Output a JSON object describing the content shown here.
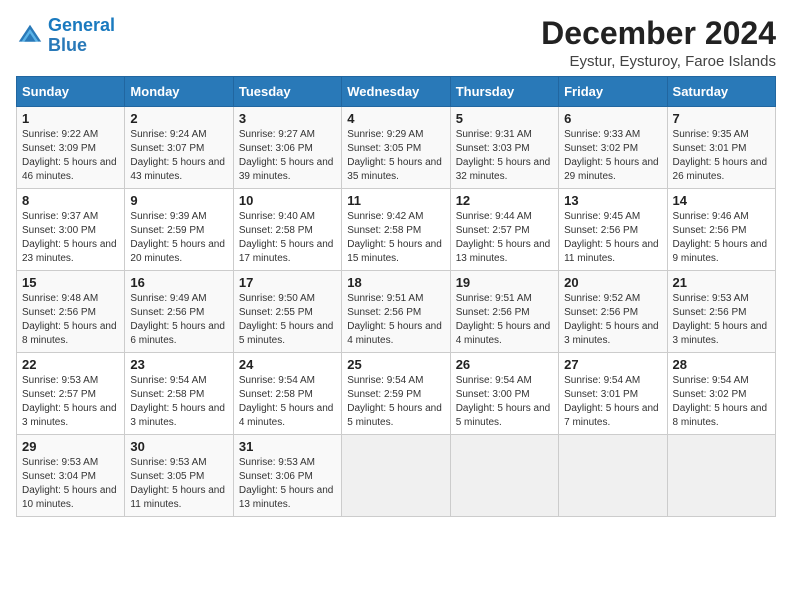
{
  "logo": {
    "line1": "General",
    "line2": "Blue"
  },
  "title": "December 2024",
  "subtitle": "Eystur, Eysturoy, Faroe Islands",
  "headers": [
    "Sunday",
    "Monday",
    "Tuesday",
    "Wednesday",
    "Thursday",
    "Friday",
    "Saturday"
  ],
  "weeks": [
    [
      {
        "day": "1",
        "sunrise": "9:22 AM",
        "sunset": "3:09 PM",
        "daylight": "5 hours and 46 minutes."
      },
      {
        "day": "2",
        "sunrise": "9:24 AM",
        "sunset": "3:07 PM",
        "daylight": "5 hours and 43 minutes."
      },
      {
        "day": "3",
        "sunrise": "9:27 AM",
        "sunset": "3:06 PM",
        "daylight": "5 hours and 39 minutes."
      },
      {
        "day": "4",
        "sunrise": "9:29 AM",
        "sunset": "3:05 PM",
        "daylight": "5 hours and 35 minutes."
      },
      {
        "day": "5",
        "sunrise": "9:31 AM",
        "sunset": "3:03 PM",
        "daylight": "5 hours and 32 minutes."
      },
      {
        "day": "6",
        "sunrise": "9:33 AM",
        "sunset": "3:02 PM",
        "daylight": "5 hours and 29 minutes."
      },
      {
        "day": "7",
        "sunrise": "9:35 AM",
        "sunset": "3:01 PM",
        "daylight": "5 hours and 26 minutes."
      }
    ],
    [
      {
        "day": "8",
        "sunrise": "9:37 AM",
        "sunset": "3:00 PM",
        "daylight": "5 hours and 23 minutes."
      },
      {
        "day": "9",
        "sunrise": "9:39 AM",
        "sunset": "2:59 PM",
        "daylight": "5 hours and 20 minutes."
      },
      {
        "day": "10",
        "sunrise": "9:40 AM",
        "sunset": "2:58 PM",
        "daylight": "5 hours and 17 minutes."
      },
      {
        "day": "11",
        "sunrise": "9:42 AM",
        "sunset": "2:58 PM",
        "daylight": "5 hours and 15 minutes."
      },
      {
        "day": "12",
        "sunrise": "9:44 AM",
        "sunset": "2:57 PM",
        "daylight": "5 hours and 13 minutes."
      },
      {
        "day": "13",
        "sunrise": "9:45 AM",
        "sunset": "2:56 PM",
        "daylight": "5 hours and 11 minutes."
      },
      {
        "day": "14",
        "sunrise": "9:46 AM",
        "sunset": "2:56 PM",
        "daylight": "5 hours and 9 minutes."
      }
    ],
    [
      {
        "day": "15",
        "sunrise": "9:48 AM",
        "sunset": "2:56 PM",
        "daylight": "5 hours and 8 minutes."
      },
      {
        "day": "16",
        "sunrise": "9:49 AM",
        "sunset": "2:56 PM",
        "daylight": "5 hours and 6 minutes."
      },
      {
        "day": "17",
        "sunrise": "9:50 AM",
        "sunset": "2:55 PM",
        "daylight": "5 hours and 5 minutes."
      },
      {
        "day": "18",
        "sunrise": "9:51 AM",
        "sunset": "2:56 PM",
        "daylight": "5 hours and 4 minutes."
      },
      {
        "day": "19",
        "sunrise": "9:51 AM",
        "sunset": "2:56 PM",
        "daylight": "5 hours and 4 minutes."
      },
      {
        "day": "20",
        "sunrise": "9:52 AM",
        "sunset": "2:56 PM",
        "daylight": "5 hours and 3 minutes."
      },
      {
        "day": "21",
        "sunrise": "9:53 AM",
        "sunset": "2:56 PM",
        "daylight": "5 hours and 3 minutes."
      }
    ],
    [
      {
        "day": "22",
        "sunrise": "9:53 AM",
        "sunset": "2:57 PM",
        "daylight": "5 hours and 3 minutes."
      },
      {
        "day": "23",
        "sunrise": "9:54 AM",
        "sunset": "2:58 PM",
        "daylight": "5 hours and 3 minutes."
      },
      {
        "day": "24",
        "sunrise": "9:54 AM",
        "sunset": "2:58 PM",
        "daylight": "5 hours and 4 minutes."
      },
      {
        "day": "25",
        "sunrise": "9:54 AM",
        "sunset": "2:59 PM",
        "daylight": "5 hours and 5 minutes."
      },
      {
        "day": "26",
        "sunrise": "9:54 AM",
        "sunset": "3:00 PM",
        "daylight": "5 hours and 5 minutes."
      },
      {
        "day": "27",
        "sunrise": "9:54 AM",
        "sunset": "3:01 PM",
        "daylight": "5 hours and 7 minutes."
      },
      {
        "day": "28",
        "sunrise": "9:54 AM",
        "sunset": "3:02 PM",
        "daylight": "5 hours and 8 minutes."
      }
    ],
    [
      {
        "day": "29",
        "sunrise": "9:53 AM",
        "sunset": "3:04 PM",
        "daylight": "5 hours and 10 minutes."
      },
      {
        "day": "30",
        "sunrise": "9:53 AM",
        "sunset": "3:05 PM",
        "daylight": "5 hours and 11 minutes."
      },
      {
        "day": "31",
        "sunrise": "9:53 AM",
        "sunset": "3:06 PM",
        "daylight": "5 hours and 13 minutes."
      },
      null,
      null,
      null,
      null
    ]
  ],
  "labels": {
    "sunrise": "Sunrise:",
    "sunset": "Sunset:",
    "daylight": "Daylight:"
  }
}
